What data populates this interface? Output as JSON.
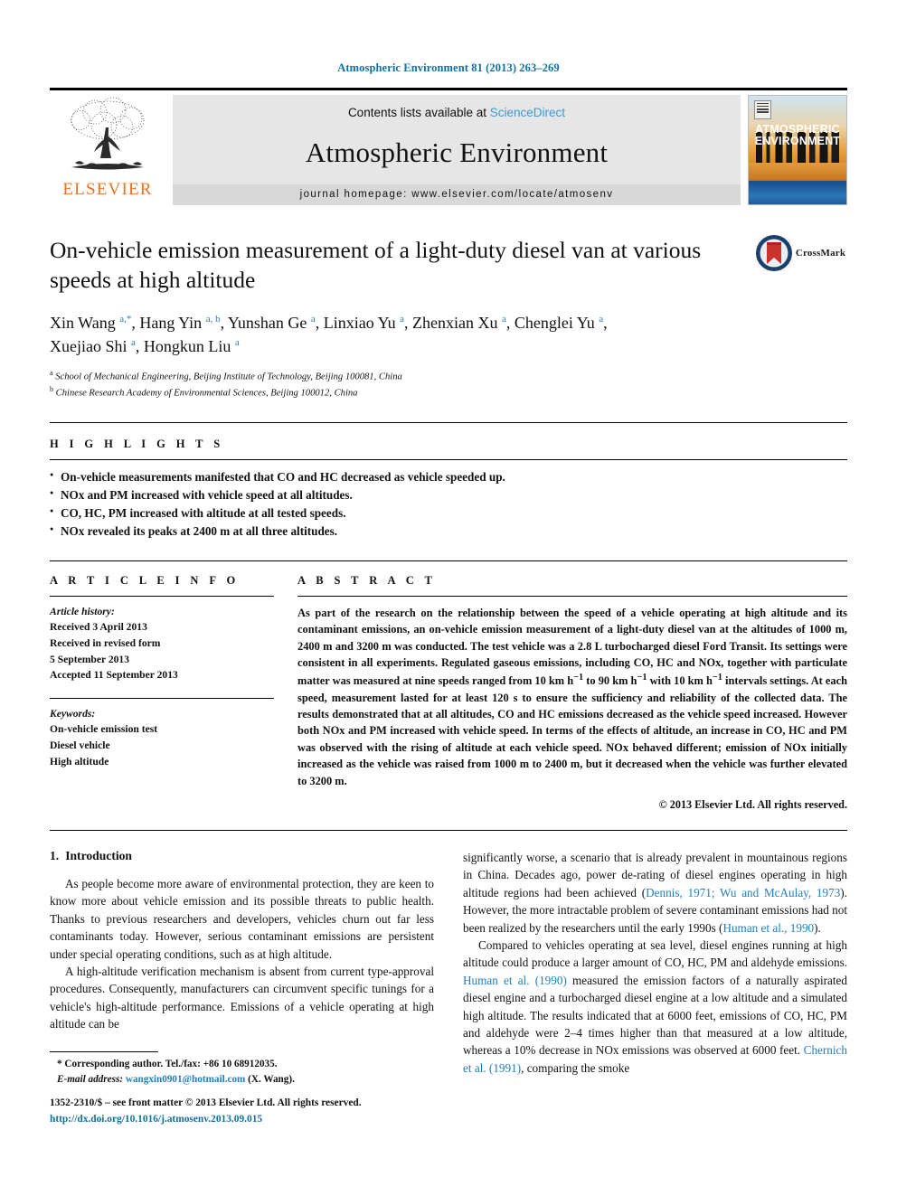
{
  "running_head": "Atmospheric Environment 81 (2013) 263–269",
  "masthead": {
    "contents_prefix": "Contents lists available at ",
    "sciencedirect": "ScienceDirect",
    "journal_name": "Atmospheric Environment",
    "homepage": "journal homepage: www.elsevier.com/locate/atmosenv",
    "publisher_word": "ELSEVIER",
    "cover_title_line1": "ATMOSPHERIC",
    "cover_title_line2": "ENVIRONMENT",
    "accent_blue": "#3d9ad1",
    "publisher_orange": "#e87422"
  },
  "article": {
    "title": "On-vehicle emission measurement of a light-duty diesel van at various speeds at high altitude",
    "crossmark_label": "CrossMark",
    "authors_line1_pre": "Xin Wang ",
    "authors": "Xin Wang a,*, Hang Yin a,b, Yunshan Ge a, Linxiao Yu a, Zhenxian Xu a, Chenglei Yu a, Xuejiao Shi a, Hongkun Liu a",
    "affiliation_a": "School of Mechanical Engineering, Beijing Institute of Technology, Beijing 100081, China",
    "affiliation_b": "Chinese Research Academy of Environmental Sciences, Beijing 100012, China"
  },
  "highlights": {
    "heading": "H I G H L I G H T S",
    "items": [
      "On-vehicle measurements manifested that CO and HC decreased as vehicle speeded up.",
      "NOx and PM increased with vehicle speed at all altitudes.",
      "CO, HC, PM increased with altitude at all tested speeds.",
      "NOx revealed its peaks at 2400 m at all three altitudes."
    ]
  },
  "article_info": {
    "heading": "A R T I C L E   I N F O",
    "history_label": "Article history:",
    "history": [
      "Received 3 April 2013",
      "Received in revised form",
      "5 September 2013",
      "Accepted 11 September 2013"
    ],
    "keywords_label": "Keywords:",
    "keywords": [
      "On-vehicle emission test",
      "Diesel vehicle",
      "High altitude"
    ]
  },
  "abstract": {
    "heading": "A B S T R A C T",
    "text_part1": "As part of the research on the relationship between the speed of a vehicle operating at high altitude and its contaminant emissions, an on-vehicle emission measurement of a light-duty diesel van at the altitudes of 1000 m, 2400 m and 3200 m was conducted. The test vehicle was a 2.8 L turbocharged diesel Ford Transit. Its settings were consistent in all experiments. Regulated gaseous emissions, including CO, HC and NOx, together with particulate matter was measured at nine speeds ranged from 10 km h",
    "sup1": "−1",
    "text_part2": " to 90 km h",
    "sup2": "−1",
    "text_part3": " with 10 km h",
    "sup3": "−1",
    "text_part4": " intervals settings. At each speed, measurement lasted for at least 120 s to ensure the sufficiency and reliability of the collected data. The results demonstrated that at all altitudes, CO and HC emissions decreased as the vehicle speed increased. However both NOx and PM increased with vehicle speed. In terms of the effects of altitude, an increase in CO, HC and PM was observed with the rising of altitude at each vehicle speed. NOx behaved different; emission of NOx initially increased as the vehicle was raised from 1000 m to 2400 m, but it decreased when the vehicle was further elevated to 3200 m.",
    "copyright": "© 2013 Elsevier Ltd. All rights reserved."
  },
  "introduction": {
    "number": "1.",
    "title": "Introduction",
    "left_paragraphs": [
      "As people become more aware of environmental protection, they are keen to know more about vehicle emission and its possible threats to public health. Thanks to previous researchers and developers, vehicles churn out far less contaminants today. However, serious contaminant emissions are persistent under special operating conditions, such as at high altitude.",
      "A high-altitude verification mechanism is absent from current type-approval procedures. Consequently, manufacturers can circumvent specific tunings for a vehicle's high-altitude performance. Emissions of a vehicle operating at high altitude can be"
    ],
    "right_paragraph1_a": "significantly worse, a scenario that is already prevalent in mountainous regions in China. Decades ago, power de-rating of diesel engines operating in high altitude regions had been achieved (",
    "right_cite1": "Dennis, 1971; Wu and McAulay, 1973",
    "right_paragraph1_b": "). However, the more intractable problem of severe contaminant emissions had not been realized by the researchers until the early 1990s (",
    "right_cite2": "Human et al., 1990",
    "right_paragraph1_c": ").",
    "right_paragraph2_a": "Compared to vehicles operating at sea level, diesel engines running at high altitude could produce a larger amount of CO, HC, PM and aldehyde emissions. ",
    "right_cite3": "Human et al. (1990)",
    "right_paragraph2_b": " measured the emission factors of a naturally aspirated diesel engine and a turbocharged diesel engine at a low altitude and a simulated high altitude. The results indicated that at 6000 feet, emissions of CO, HC, PM and aldehyde were 2–4 times higher than that measured at a low altitude, whereas a 10% decrease in NOx emissions was observed at 6000 feet. ",
    "right_cite4": "Chernich et al. (1991)",
    "right_paragraph2_c": ", comparing the smoke"
  },
  "footnote": {
    "corresponding": "* Corresponding author. Tel./fax: +86 10 68912035.",
    "email_label": "E-mail address:",
    "email": "wangxin0901@hotmail.com",
    "email_suffix": "(X. Wang)."
  },
  "front_matter": {
    "line": "1352-2310/$ – see front matter © 2013 Elsevier Ltd. All rights reserved.",
    "doi": "http://dx.doi.org/10.1016/j.atmosenv.2013.09.015"
  }
}
